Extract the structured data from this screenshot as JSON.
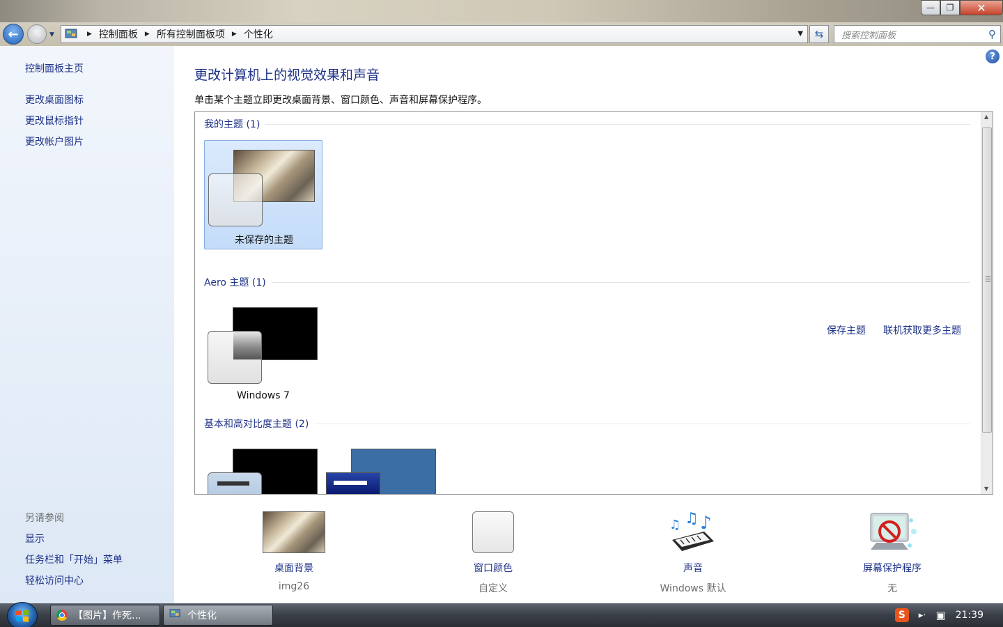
{
  "window": {
    "controls": {
      "minimize": "—",
      "maximize": "❐",
      "close": "✕"
    }
  },
  "navbar": {
    "breadcrumbs": [
      "控制面板",
      "所有控制面板项",
      "个性化"
    ],
    "search_placeholder": "搜索控制面板"
  },
  "sidebar": {
    "home": "控制面板主页",
    "links": [
      "更改桌面图标",
      "更改鼠标指针",
      "更改帐户图片"
    ],
    "see_also_title": "另请参阅",
    "see_also": [
      "显示",
      "任务栏和「开始」菜单",
      "轻松访问中心"
    ]
  },
  "main": {
    "title": "更改计算机上的视觉效果和声音",
    "subtitle": "单击某个主题立即更改桌面背景、窗口颜色、声音和屏幕保护程序。",
    "help": "?",
    "groups": {
      "my": {
        "title": "我的主题 (1)",
        "themes": [
          "未保存的主题"
        ]
      },
      "aero": {
        "title": "Aero 主题 (1)",
        "themes": [
          "Windows 7"
        ]
      },
      "basic": {
        "title": "基本和高对比度主题 (2)"
      }
    },
    "actions": {
      "save": "保存主题",
      "online": "联机获取更多主题"
    }
  },
  "bottom": [
    {
      "label": "桌面背景",
      "value": "img26"
    },
    {
      "label": "窗口颜色",
      "value": "自定义"
    },
    {
      "label": "声音",
      "value": "Windows 默认"
    },
    {
      "label": "屏幕保护程序",
      "value": "无"
    }
  ],
  "taskbar": {
    "buttons": [
      "【图片】作死...",
      "个性化"
    ],
    "clock": "21:39"
  },
  "colors": {
    "link": "#1e3287",
    "selection": "#c4dcf9",
    "basic_blue": "#3a6ea5"
  }
}
